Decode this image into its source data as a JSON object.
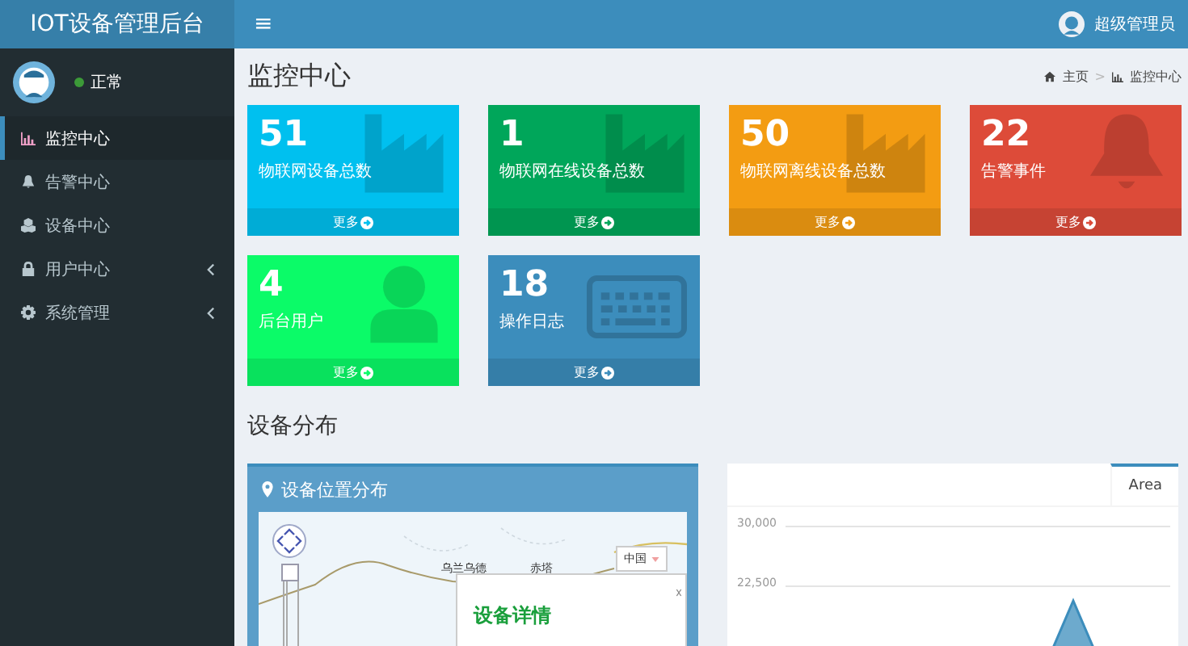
{
  "header": {
    "logo": "IOT设备管理后台",
    "menu_toggle": "≡",
    "user_name": "超级管理员"
  },
  "sidebar": {
    "user_status": "正常",
    "items": [
      {
        "label": "监控中心",
        "selected": true,
        "has_submenu": false
      },
      {
        "label": "告警中心",
        "selected": false,
        "has_submenu": false
      },
      {
        "label": "设备中心",
        "selected": false,
        "has_submenu": false
      },
      {
        "label": "用户中心",
        "selected": false,
        "has_submenu": true
      },
      {
        "label": "系统管理",
        "selected": false,
        "has_submenu": true
      }
    ]
  },
  "page": {
    "title": "监控中心",
    "breadcrumb": [
      "主页",
      "监控中心"
    ],
    "breadcrumb_separator": ">"
  },
  "cards": [
    {
      "value": "51",
      "label": "物联网设备总数",
      "more": "更多",
      "color": "#00c0ef"
    },
    {
      "value": "1",
      "label": "物联网在线设备总数",
      "more": "更多",
      "color": "#00a65a"
    },
    {
      "value": "50",
      "label": "物联网离线设备总数",
      "more": "更多",
      "color": "#f39c12"
    },
    {
      "value": "22",
      "label": "告警事件",
      "more": "更多",
      "color": "#dd4b39"
    },
    {
      "value": "4",
      "label": "后台用户",
      "more": "更多",
      "color": "#0bfb68"
    },
    {
      "value": "18",
      "label": "操作日志",
      "more": "更多",
      "color": "#3c8dbc"
    }
  ],
  "section_title": "设备分布",
  "map_panel": {
    "title": "设备位置分布",
    "cities": [
      "乌兰乌德",
      "赤塔"
    ],
    "region_select": "中国",
    "info_window": {
      "title": "设备详情"
    }
  },
  "chart_panel": {
    "tabs": [
      {
        "label": "Area",
        "selected": true
      }
    ],
    "y_axis_labels": [
      "30,000",
      "22,500"
    ]
  }
}
